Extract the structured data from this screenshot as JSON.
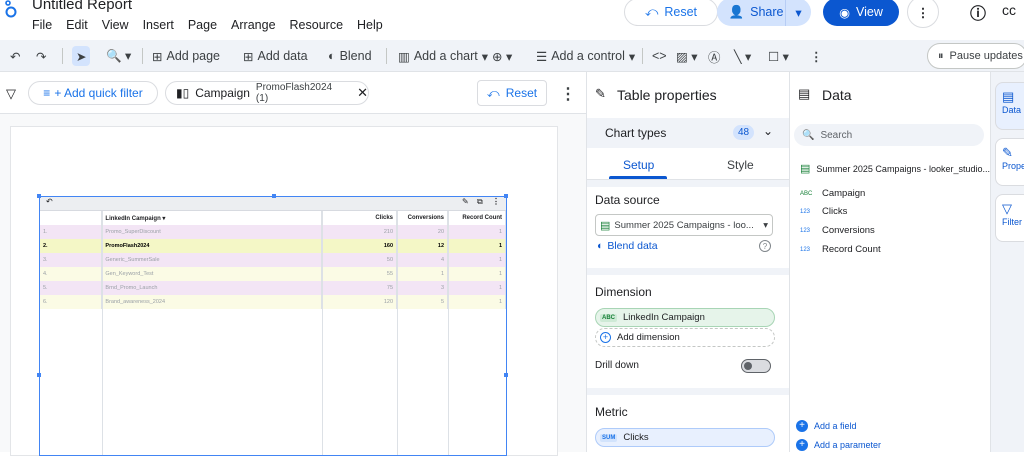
{
  "header": {
    "title": "Untitled Report",
    "menu": [
      "File",
      "Edit",
      "View",
      "Insert",
      "Page",
      "Arrange",
      "Resource",
      "Help"
    ],
    "reset_label": "Reset",
    "share_label": "Share",
    "view_label": "View"
  },
  "toolbar": {
    "add_page": "Add page",
    "add_data": "Add data",
    "blend": "Blend",
    "add_chart": "Add a chart",
    "add_control": "Add a control",
    "pause_updates": "Pause updates"
  },
  "filterbar": {
    "add_quick_filter": "+ Add quick filter",
    "campaign_label": "Campaign",
    "campaign_value": "PromoFlash2024 (1)",
    "reset_label": "Reset"
  },
  "table": {
    "headers": [
      "",
      "LinkedIn Campaign",
      "Clicks",
      "Conversions",
      "Record Count"
    ],
    "rows": [
      {
        "idx": "1.",
        "name": "Promo_SuperDiscount",
        "clicks": "210",
        "conv": "20",
        "count": "1"
      },
      {
        "idx": "2.",
        "name": "PromoFlash2024",
        "clicks": "160",
        "conv": "12",
        "count": "1"
      },
      {
        "idx": "3.",
        "name": "Generic_SummerSale",
        "clicks": "50",
        "conv": "4",
        "count": "1"
      },
      {
        "idx": "4.",
        "name": "Gen_Keyword_Test",
        "clicks": "55",
        "conv": "1",
        "count": "1"
      },
      {
        "idx": "5.",
        "name": "Brnd_Promo_Launch",
        "clicks": "75",
        "conv": "3",
        "count": "1"
      },
      {
        "idx": "6.",
        "name": "Brand_awareness_2024",
        "clicks": "120",
        "conv": "5",
        "count": "1"
      }
    ],
    "row_colors": [
      "#f3e5f5",
      "#f4f7c6",
      "#f3e5f5",
      "#fbfbe5",
      "#f3e5f5",
      "#fbfbe5"
    ]
  },
  "props": {
    "title": "Table properties",
    "chart_types": "Chart types",
    "chart_types_count": "48",
    "tab_setup": "Setup",
    "tab_style": "Style",
    "data_source_title": "Data source",
    "data_source_value": "Summer 2025 Campaigns - loo...",
    "blend_data": "Blend data",
    "dimension_title": "Dimension",
    "dimension_value": "LinkedIn Campaign",
    "add_dimension": "Add dimension",
    "drill_down": "Drill down",
    "metric_title": "Metric",
    "metric_value": "Clicks"
  },
  "datapanel": {
    "title": "Data",
    "search_placeholder": "Search",
    "source": "Summer 2025 Campaigns - looker_studio...",
    "fields": [
      {
        "type": "ABC",
        "name": "Campaign"
      },
      {
        "type": "123",
        "name": "Clicks"
      },
      {
        "type": "123",
        "name": "Conversions"
      },
      {
        "type": "123",
        "name": "Record Count"
      }
    ],
    "add_field": "Add a field",
    "add_parameter": "Add a parameter"
  },
  "rail": {
    "data": "Data",
    "properties": "Properties",
    "filter": "Filter"
  }
}
